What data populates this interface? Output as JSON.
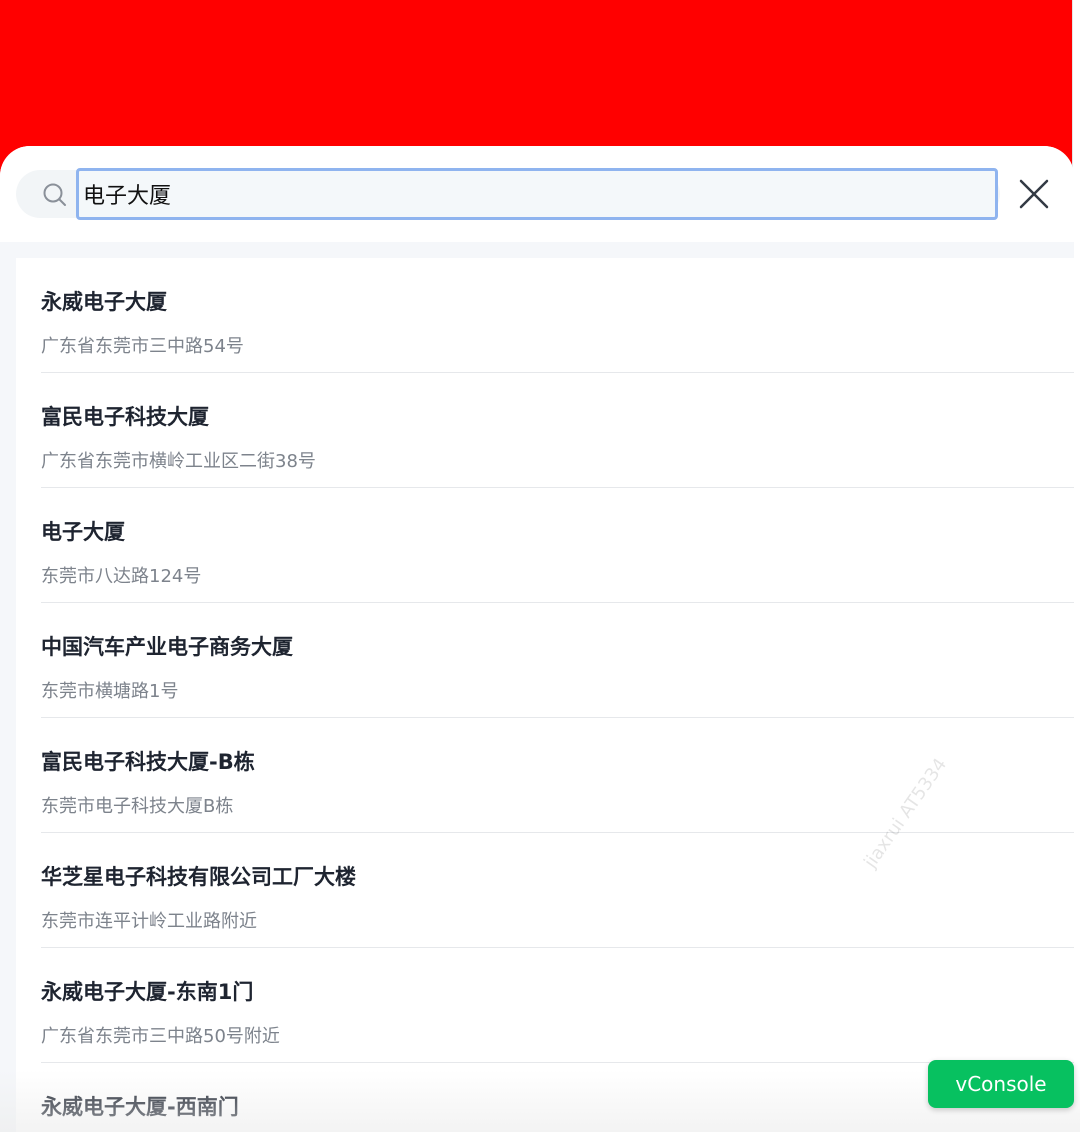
{
  "search": {
    "value": "电子大厦"
  },
  "results": [
    {
      "title": "永威电子大厦",
      "address": "广东省东莞市三中路54号"
    },
    {
      "title": "富民电子科技大厦",
      "address": "广东省东莞市横岭工业区二街38号"
    },
    {
      "title": "电子大厦",
      "address": "东莞市八达路124号"
    },
    {
      "title": "中国汽车产业电子商务大厦",
      "address": "东莞市横塘路1号"
    },
    {
      "title": "富民电子科技大厦-B栋",
      "address": "东莞市电子科技大厦B栋"
    },
    {
      "title": "华芝星电子科技有限公司工厂大楼",
      "address": "东莞市连平计岭工业路附近"
    },
    {
      "title": "永威电子大厦-东南1门",
      "address": "广东省东莞市三中路50号附近"
    },
    {
      "title": "永威电子大厦-西南门",
      "address": ""
    }
  ],
  "watermark": "jiaxrui   AT5334",
  "vconsole": {
    "label": "vConsole"
  },
  "colors": {
    "banner": "#ff0000",
    "vconsole": "#07c160",
    "input_border": "#8fb4ef"
  }
}
